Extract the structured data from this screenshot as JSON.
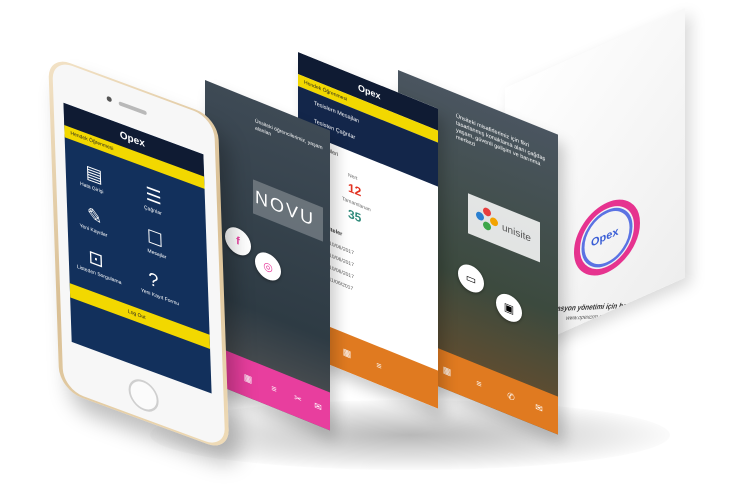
{
  "phone": {
    "header_label": "Hendek Öğrenmesi",
    "logo": "Opex",
    "tiles": [
      "Hata Girişi",
      "Çağrılar",
      "Yeni Kayıtlar",
      "Mesajlar",
      "Listeden Sorgulama",
      "Yeni Kayıt Formu"
    ],
    "logout": "Log Out",
    "accent": "#f2d800",
    "bg": "#12305c"
  },
  "screen_novu": {
    "intro": "Ünsiteki öğrencilerimiz, yaşam alanları",
    "brand": "NOVU",
    "social": [
      "facebook-icon",
      "instagram-icon"
    ],
    "accent": "#e83e9e"
  },
  "screen_dates": {
    "header_label": "Hendek Öğrenmesi",
    "logo": "Opex",
    "menu": [
      "Tesislern Mesajları",
      "Tesisten Çağrılar"
    ],
    "date_label": "Gün: Önerileri",
    "days": [
      {
        "label": "Nert",
        "value": "12",
        "color": "#e2301f"
      },
      {
        "label": "Tamamlanan",
        "value": "35",
        "color": "#2e8a7a"
      }
    ],
    "list_title": "Son Aktiviteler",
    "list": [
      "10:15 - 10/06/2017",
      "10:15 - 10/06/2017",
      "10:15 - 10/06/2017",
      "11:20 - 11/06/2017"
    ]
  },
  "screen_unisite": {
    "intro": "Ünsiteki misafirlerimiz için fikri tasarlanmış konaklama alanı çağdaş yaşam, güvenli gelişim ve barınma merkezi",
    "brand": "unisite",
    "accent": "#e07a20"
  },
  "screen_splash": {
    "logo": "Opex",
    "tagline": "Operasyon yönetimi için herşey...",
    "url": "www.opexcrm.net",
    "ring_colors": [
      "#e6338f",
      "#4a6fe0"
    ]
  }
}
